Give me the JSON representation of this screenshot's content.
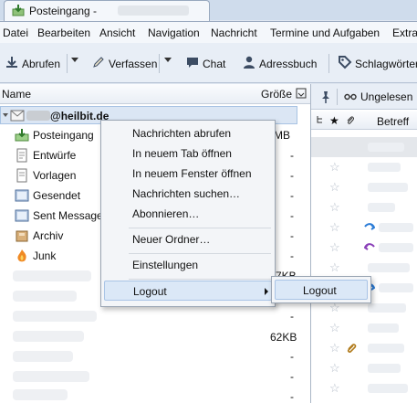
{
  "window": {
    "tab_title": "Posteingang -"
  },
  "menubar": [
    "Datei",
    "Bearbeiten",
    "Ansicht",
    "Navigation",
    "Nachricht",
    "Termine und Aufgaben",
    "Extras"
  ],
  "toolbar": {
    "get_mail": "Abrufen",
    "compose": "Verfassen",
    "chat": "Chat",
    "address_book": "Adressbuch",
    "tags": "Schlagwörter"
  },
  "folder_pane": {
    "col_name": "Name",
    "col_size": "Größe",
    "account": "@heilbit.de",
    "folders": [
      {
        "label": "Posteingang",
        "size": "MB",
        "icon": "inbox-icon"
      },
      {
        "label": "Entwürfe",
        "size": "-",
        "icon": "drafts-icon"
      },
      {
        "label": "Vorlagen",
        "size": "-",
        "icon": "templates-icon"
      },
      {
        "label": "Gesendet",
        "size": "-",
        "icon": "sent-icon"
      },
      {
        "label": "Sent Messages",
        "size": "-",
        "icon": "sent-icon"
      },
      {
        "label": "Archiv",
        "size": "-",
        "icon": "archive-icon"
      },
      {
        "label": "Junk",
        "size": "-",
        "icon": "junk-icon"
      }
    ],
    "extra_sizes": [
      "7KB",
      "-",
      "62KB",
      "-",
      "-",
      "-",
      "-"
    ]
  },
  "message_pane": {
    "unread_filter": "Ungelesen",
    "col_subject": "Betreff"
  },
  "context_menu": {
    "items": [
      "Nachrichten abrufen",
      "In neuem Tab öffnen",
      "In neuem Fenster öffnen",
      "Nachrichten suchen…",
      "Abonnieren…",
      "Neuer Ordner…",
      "Einstellungen",
      "Logout"
    ],
    "submenu": [
      "Logout"
    ]
  },
  "colors": {
    "accent": "#3a6db5",
    "highlight": "#dbe8f7"
  }
}
